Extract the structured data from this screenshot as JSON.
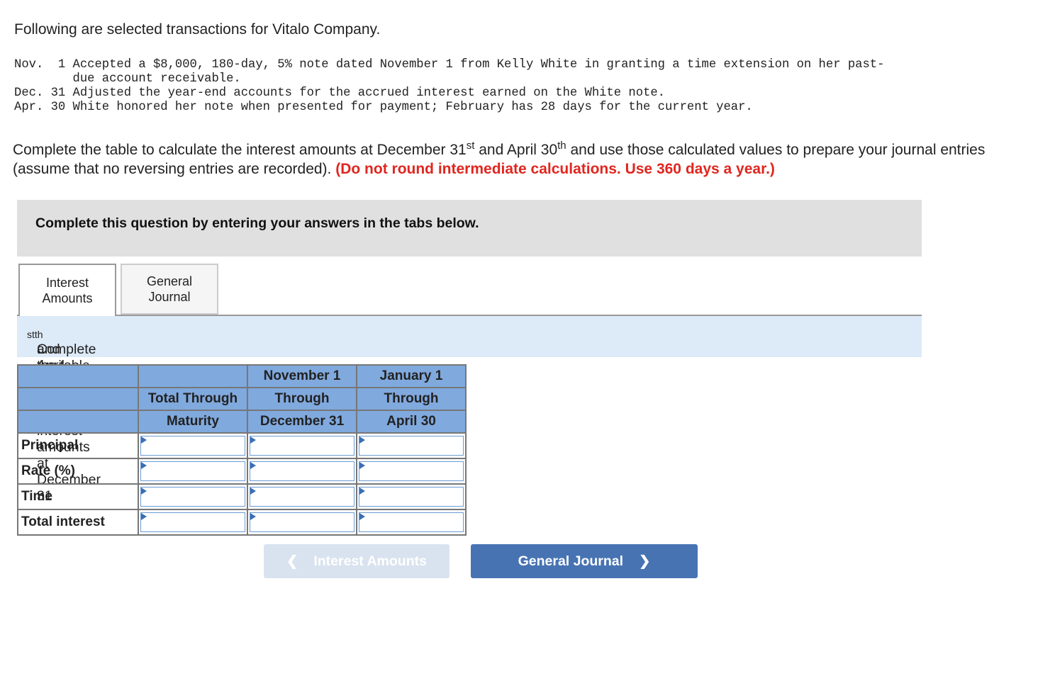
{
  "intro": "Following are selected transactions for Vitalo Company.",
  "transactions": "Nov.  1 Accepted a $8,000, 180-day, 5% note dated November 1 from Kelly White in granting a time extension on her past-\n        due account receivable.\nDec. 31 Adjusted the year-end accounts for the accrued interest earned on the White note.\nApr. 30 White honored her note when presented for payment; February has 28 days for the current year.",
  "instructions": {
    "p1": "Complete the table to calculate the interest amounts at December 31",
    "sup1": "st",
    "p2": " and April 30",
    "sup2": "th",
    "p3": " and use those calculated values to prepare your journal entries (assume that no reversing entries are recorded). ",
    "red": "(Do not round intermediate calculations. Use 360 days a year.)"
  },
  "banner": "Complete this question by entering your answers in the tabs below.",
  "tabs": [
    {
      "l1": "Interest",
      "l2": "Amounts"
    },
    {
      "l1": "General",
      "l2": "Journal"
    }
  ],
  "subheader": {
    "p1": "Complete the table to calculate the interest amounts at December 31",
    "sup1": "st",
    "p2": " and April 30",
    "sup2": "th",
    "p3": "."
  },
  "table": {
    "headers": [
      [
        "",
        "",
        "November 1",
        "January 1"
      ],
      [
        "",
        "Total Through",
        "Through",
        "Through"
      ],
      [
        "",
        "Maturity",
        "December 31",
        "April 30"
      ]
    ],
    "rows": [
      "Principal",
      "Rate (%)",
      "Time",
      "Total interest"
    ]
  },
  "buttons": {
    "prev": "Interest Amounts",
    "next": "General Journal"
  },
  "colors": {
    "header": "#80a9de",
    "next_button": "#4773b3",
    "warning": "#e0261f"
  }
}
